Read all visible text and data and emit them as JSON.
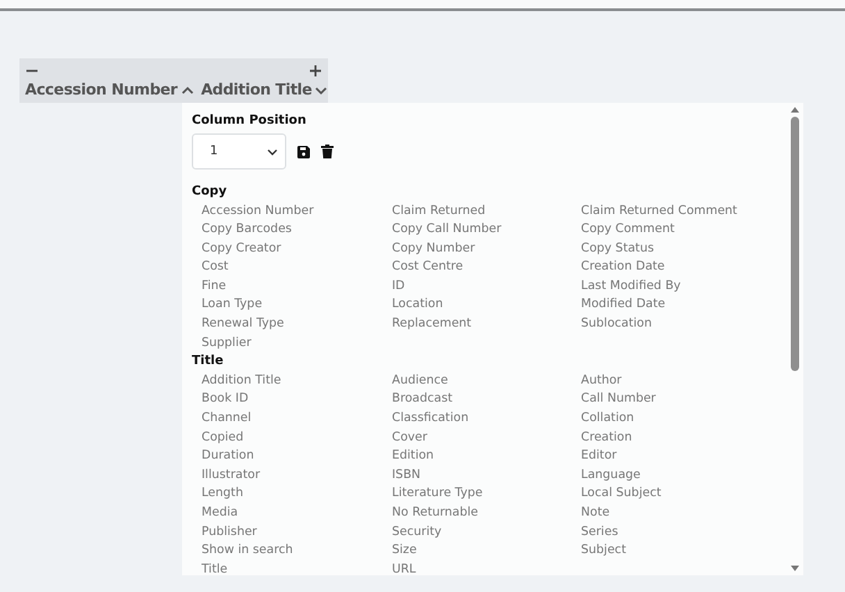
{
  "header": {
    "columns": [
      {
        "label": "Accession Number",
        "ascending": true
      },
      {
        "label": "Addition Title",
        "ascending": false
      }
    ]
  },
  "panel": {
    "position_label": "Column Position",
    "position_value": "1",
    "groups": [
      {
        "title": "Copy",
        "fields": [
          "Accession Number",
          "Claim Returned",
          "Claim Returned Comment",
          "Copy Barcodes",
          "Copy Call Number",
          "Copy Comment",
          "Copy Creator",
          "Copy Number",
          "Copy Status",
          "Cost",
          "Cost Centre",
          "Creation Date",
          "Fine",
          "ID",
          "Last Modified By",
          "Loan Type",
          "Location",
          "Modified Date",
          "Renewal Type",
          "Replacement",
          "Sublocation",
          "Supplier"
        ]
      },
      {
        "title": "Title",
        "fields": [
          "Addition Title",
          "Audience",
          "Author",
          "Book ID",
          "Broadcast",
          "Call Number",
          "Channel",
          "Classfication",
          "Collation",
          "Copied",
          "Cover",
          "Creation",
          "Duration",
          "Edition",
          "Editor",
          "Illustrator",
          "ISBN",
          "Language",
          "Length",
          "Literature Type",
          "Local Subject",
          "Media",
          "No Returnable",
          "Note",
          "Publisher",
          "Security",
          "Series",
          "Show in search",
          "Size",
          "Subject",
          "Title",
          "URL"
        ]
      }
    ]
  }
}
